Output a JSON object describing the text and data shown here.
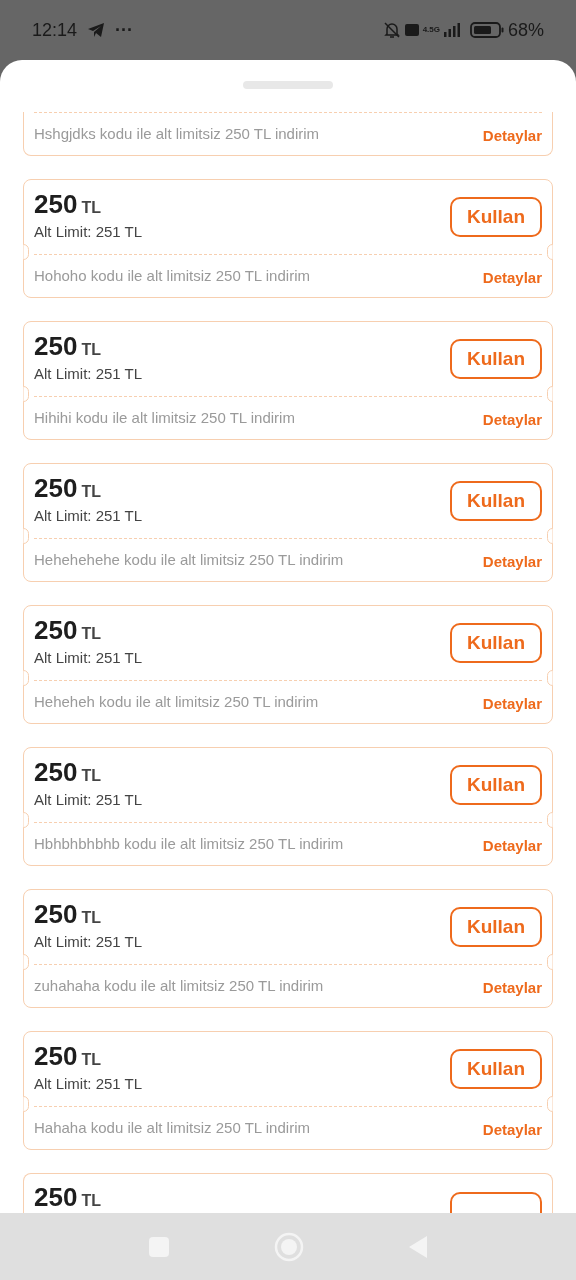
{
  "status_bar": {
    "time": "12:14",
    "more": "···",
    "network": "4.5G",
    "battery": "68%"
  },
  "coupons": [
    {
      "kind": "tail",
      "description": "Hshgjdks kodu ile alt limitsiz 250 TL indirim",
      "details": "Detaylar"
    },
    {
      "kind": "full",
      "amount": "250",
      "currency": "TL",
      "min_limit": "Alt Limit: 251 TL",
      "action": "Kullan",
      "description": "Hohoho kodu ile alt limitsiz 250 TL indirim",
      "details": "Detaylar"
    },
    {
      "kind": "full",
      "amount": "250",
      "currency": "TL",
      "min_limit": "Alt Limit: 251 TL",
      "action": "Kullan",
      "description": "Hihihi kodu ile alt limitsiz 250 TL indirim",
      "details": "Detaylar"
    },
    {
      "kind": "full",
      "amount": "250",
      "currency": "TL",
      "min_limit": "Alt Limit: 251 TL",
      "action": "Kullan",
      "description": "Hehehehehe kodu ile alt limitsiz 250 TL indirim",
      "details": "Detaylar"
    },
    {
      "kind": "full",
      "amount": "250",
      "currency": "TL",
      "min_limit": "Alt Limit: 251 TL",
      "action": "Kullan",
      "description": "Heheheh kodu ile alt limitsiz 250 TL indirim",
      "details": "Detaylar"
    },
    {
      "kind": "full",
      "amount": "250",
      "currency": "TL",
      "min_limit": "Alt Limit: 251 TL",
      "action": "Kullan",
      "description": "Hbhbhbhbhb kodu ile alt limitsiz 250 TL indirim",
      "details": "Detaylar"
    },
    {
      "kind": "full",
      "amount": "250",
      "currency": "TL",
      "min_limit": "Alt Limit: 251 TL",
      "action": "Kullan",
      "description": "zuhahaha kodu ile alt limitsiz 250 TL indirim",
      "details": "Detaylar"
    },
    {
      "kind": "full",
      "amount": "250",
      "currency": "TL",
      "min_limit": "Alt Limit: 251 TL",
      "action": "Kullan",
      "description": "Hahaha kodu ile alt limitsiz 250 TL indirim",
      "details": "Detaylar"
    },
    {
      "kind": "head",
      "amount": "250",
      "currency": "TL"
    }
  ]
}
